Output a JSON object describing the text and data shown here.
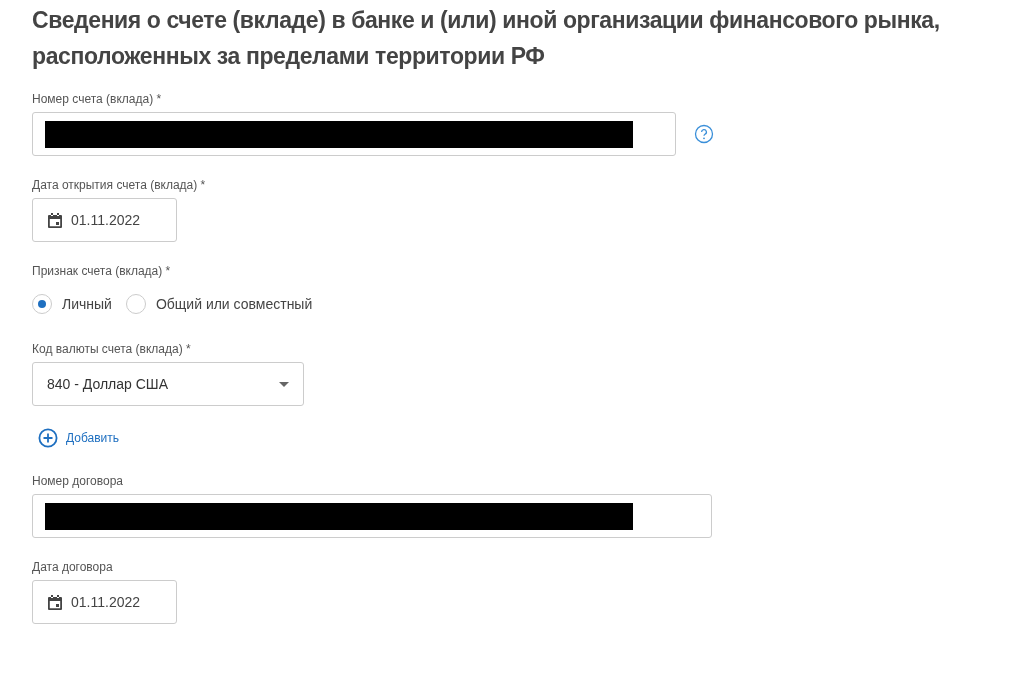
{
  "title": "Сведения о счете (вкладе) в банке и (или) иной организации финансового рынка, расположенных за пределами территории РФ",
  "fields": [
    {
      "kind": "text",
      "label": "Номер счета (вклада) *",
      "redacted": true,
      "help": true
    },
    {
      "kind": "date",
      "label": "Дата открытия счета (вклада) *",
      "value": "01.11.2022"
    },
    {
      "kind": "radio",
      "label": "Признак счета (вклада) *",
      "options": [
        {
          "label": "Личный",
          "selected": true
        },
        {
          "label": "Общий или совместный",
          "selected": false
        }
      ]
    },
    {
      "kind": "select",
      "label": "Код валюты счета (вклада) *",
      "value": "840 - Доллар США"
    },
    {
      "kind": "add",
      "label": "Добавить"
    },
    {
      "kind": "text",
      "label": "Номер договора",
      "redacted": true,
      "help": false
    },
    {
      "kind": "date",
      "label": "Дата договора",
      "value": "01.11.2022"
    }
  ]
}
